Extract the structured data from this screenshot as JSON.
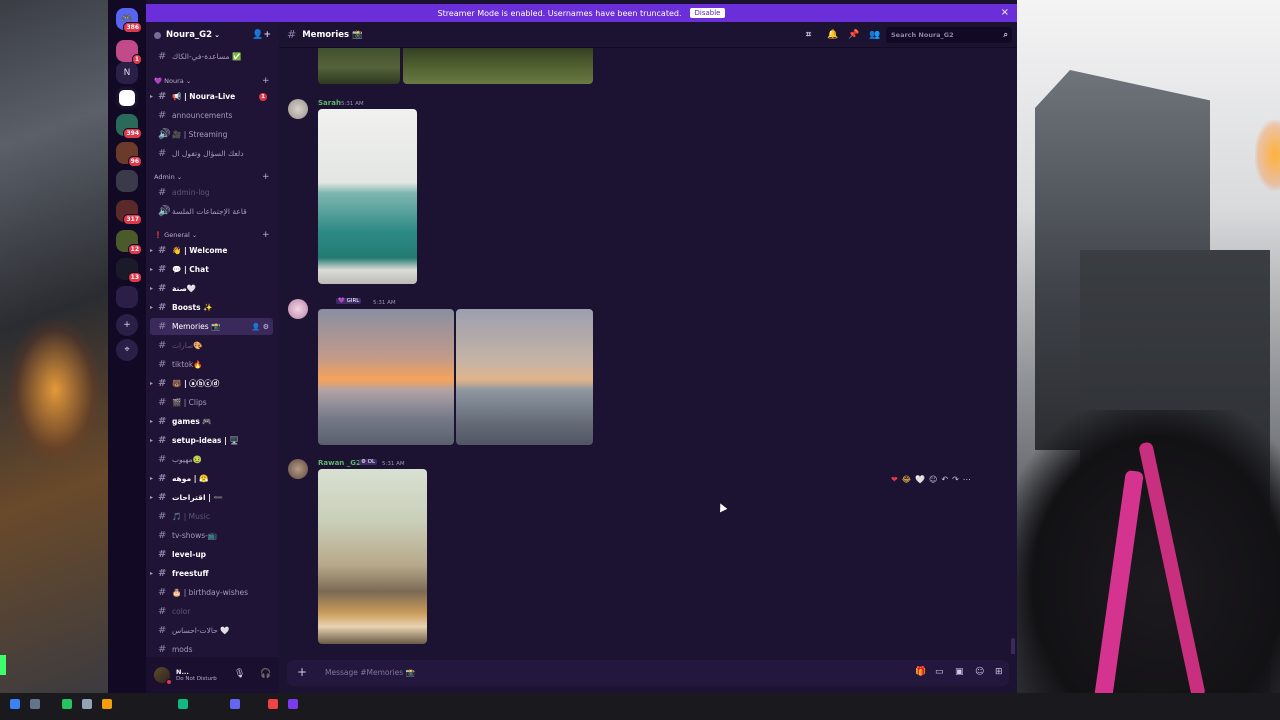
{
  "banner": {
    "text": "Streamer Mode is enabled. Usernames have been truncated.",
    "disable_label": "Disable",
    "close_icon": "×"
  },
  "guilds": {
    "home_badge": "386",
    "badges": [
      "1",
      "394",
      "96",
      "317",
      "12",
      "13"
    ],
    "n_label": "N",
    "add_icon": "+",
    "explore_icon": "⌖"
  },
  "server": {
    "name": "Noura_G2",
    "invite_icon": "👤+"
  },
  "channels": {
    "top_item": "مساعدة-في-الكاك ✅",
    "cat_noura": "💜 Noura",
    "noura_live": "📢 | Noura-Live",
    "noura_live_badge": "1",
    "announcements": "announcements",
    "streaming": "🎥 | Streaming",
    "question": "دلعك السؤال وتفول ال",
    "cat_admin": "Admin",
    "admin_log": "admin-log",
    "meetings": "قاعة الإجتماعات الملسة",
    "cat_general": "❗ General",
    "welcome": "👋 | Welcome",
    "chat": "💬 | Chat",
    "senna": "صنة🤍",
    "boosts": "Boosts ✨",
    "memories": "Memories 📸",
    "suggestions": "صارات🎨",
    "tiktok": "tiktok🔥",
    "emoji_ch": "🐻 | ⓐⓑⓒⓓ",
    "clips": "🎬 | Clips",
    "games": "games 🎮",
    "setup": "setup-ideas | 🖥️",
    "muhyoon": "مهيوب🤢",
    "mooh": "موهه | 😤",
    "iqtirahat": "اقتراحات | ➖",
    "music": "🎵 | Music",
    "tvshows": "tv-shows-📺",
    "levelup": "level-up",
    "freestuff": "freestuff",
    "birthday": "🎂 | birthday-wishes",
    "color": "color",
    "halat": "حالات-احساس 🤍",
    "mods": "mods"
  },
  "user": {
    "name": "N...",
    "status": "Do Not Disturb",
    "mic_icon": "🎙",
    "headphone_icon": "🎧",
    "settings_icon": "⚙"
  },
  "main": {
    "channel_title": "Memories 📸",
    "search_placeholder": "Search Noura_G2",
    "composer_placeholder": "Message #Memories 📸",
    "composer_plus": "+"
  },
  "messages": [
    {
      "author": "Sarah",
      "author_color": "#5fb86a",
      "time": "5:31 AM"
    },
    {
      "author": "",
      "tag": "💜 GIRL",
      "time": "5:31 AM"
    },
    {
      "author": "Rawan _G2",
      "author_color": "#5fb86a",
      "tag": "⚙ OL",
      "time": "5:31 AM"
    }
  ],
  "reactions": [
    "❤",
    "😂",
    "🤍",
    "☺",
    "↶",
    "↷",
    "⋯"
  ],
  "colors": {
    "accent": "#6b2fd9",
    "bg": "#1c1232",
    "sidebar": "#1f1336",
    "mention": "#e0384b"
  }
}
